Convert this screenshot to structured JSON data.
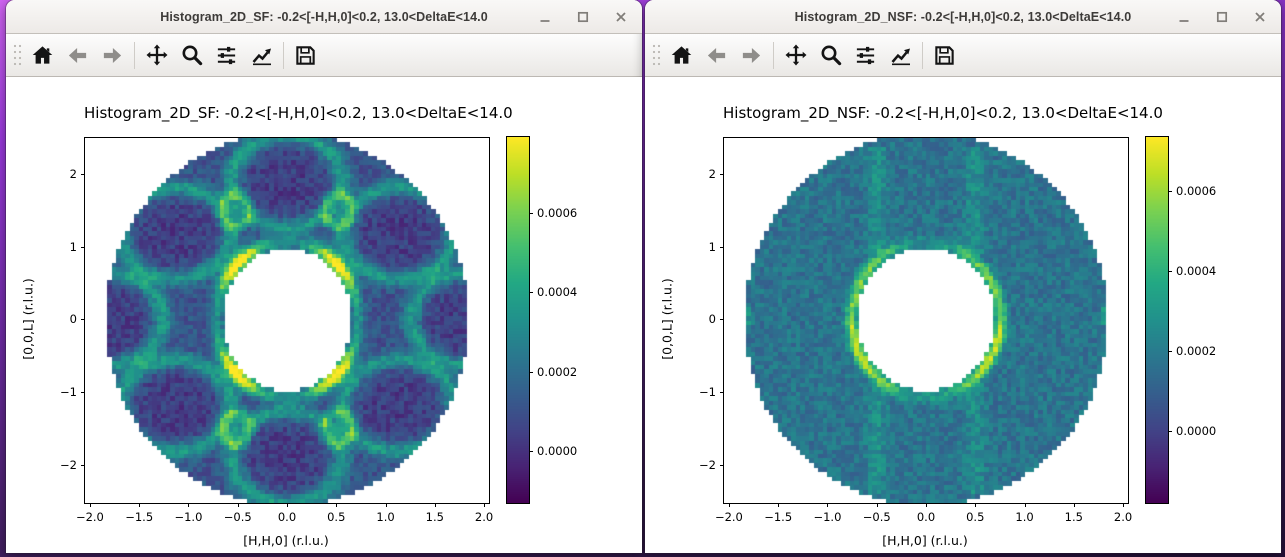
{
  "colors": {
    "desktop_top": "#d064f2",
    "desktop_bottom": "#241038",
    "titlebar_text": "#3d3b39",
    "toolbar_icon": "#141414",
    "toolbar_icon_disabled": "#8f8d8a",
    "colormap": "viridis"
  },
  "windows": [
    {
      "title": "Histogram_2D_SF: -0.2<[-H,H,0]<0.2, 13.0<DeltaE<14.0",
      "controls": [
        "minimize",
        "maximize",
        "close"
      ],
      "toolbar_icons": [
        "home",
        "back",
        "forward",
        "pan",
        "zoom",
        "configure-subplots",
        "edit-parameters",
        "save"
      ],
      "figure": {
        "title": "Histogram_2D_SF: -0.2<[-H,H,0]<0.2, 13.0<DeltaE<14.0",
        "xlabel": "[H,H,0] (r.l.u.)",
        "ylabel": "[0,0,L] (r.l.u.)"
      }
    },
    {
      "title": "Histogram_2D_NSF: -0.2<[-H,H,0]<0.2, 13.0<DeltaE<14.0",
      "controls": [
        "minimize",
        "maximize",
        "close"
      ],
      "toolbar_icons": [
        "home",
        "back",
        "forward",
        "pan",
        "zoom",
        "configure-subplots",
        "edit-parameters",
        "save"
      ],
      "figure": {
        "title": "Histogram_2D_NSF: -0.2<[-H,H,0]<0.2, 13.0<DeltaE<14.0",
        "xlabel": "[H,H,0] (r.l.u.)",
        "ylabel": "[0,0,L] (r.l.u.)"
      }
    }
  ],
  "chart_data": [
    {
      "type": "heatmap",
      "title": "Histogram_2D_SF: -0.2<[-H,H,0]<0.2, 13.0<DeltaE<14.0",
      "xlabel": "[H,H,0] (r.l.u.)",
      "ylabel": "[0,0,L] (r.l.u.)",
      "colormap": "viridis",
      "x_range": [
        -2.05,
        2.05
      ],
      "y_range": [
        -2.53,
        2.5
      ],
      "xticks": {
        "values": [
          -2.0,
          -1.5,
          -1.0,
          -0.5,
          0.0,
          0.5,
          1.0,
          1.5,
          2.0
        ],
        "labels": [
          "−2.0",
          "−1.5",
          "−1.0",
          "−0.5",
          "0.0",
          "0.5",
          "1.0",
          "1.5",
          "2.0"
        ]
      },
      "yticks": {
        "values": [
          -2,
          -1,
          0,
          1,
          2
        ],
        "labels": [
          "−2",
          "−1",
          "0",
          "1",
          "2"
        ]
      },
      "vmin": -0.000131,
      "vmax": 0.000792,
      "colorbar_ticks": {
        "values": [
          0.0,
          0.0002,
          0.0004,
          0.0006
        ],
        "labels": [
          "0.0000",
          "0.0002",
          "0.0004",
          "0.0006"
        ]
      },
      "annulus": {
        "outer_semi_axes": [
          1.84,
          2.56
        ],
        "inner_semi_axes": [
          0.655,
          0.985
        ]
      },
      "render": {
        "seed": 7,
        "bins": [
          90,
          82
        ],
        "base": 0.00013,
        "noise": 7.5e-05,
        "dark_blobs": {
          "amp": 0.0001,
          "sigma": [
            0.42,
            0.46
          ],
          "centers": [
            [
              0,
              1.9
            ],
            [
              0,
              -1.9
            ],
            [
              1.13,
              1.19
            ],
            [
              -1.13,
              1.19
            ],
            [
              1.13,
              -1.19
            ],
            [
              -1.13,
              -1.19
            ],
            [
              1.82,
              0
            ],
            [
              -1.82,
              0
            ]
          ]
        },
        "halos": {
          "amp": 0.00028,
          "width": 0.13,
          "rx": 0.56,
          "ry": 0.63,
          "centers": [
            [
              0,
              1.9
            ],
            [
              0,
              -1.9
            ],
            [
              1.13,
              1.19
            ],
            [
              -1.13,
              1.19
            ],
            [
              1.13,
              -1.19
            ],
            [
              -1.13,
              -1.19
            ],
            [
              1.82,
              0
            ],
            [
              -1.82,
              0
            ]
          ]
        },
        "loops": {
          "amp": 0.00026,
          "width": 0.25,
          "rx": 0.14,
          "ry": 0.22,
          "centers": [
            [
              0.52,
              1.5
            ],
            [
              -0.52,
              1.5
            ],
            [
              0.52,
              -1.5
            ],
            [
              -0.52,
              -1.5
            ]
          ]
        },
        "rim": {
          "rx": 0.72,
          "ry": 1.07,
          "w": 0.07,
          "base": 0.00022,
          "diag": 0.00055,
          "diag_pow": 3
        }
      }
    },
    {
      "type": "heatmap",
      "title": "Histogram_2D_NSF: -0.2<[-H,H,0]<0.2, 13.0<DeltaE<14.0",
      "xlabel": "[H,H,0] (r.l.u.)",
      "ylabel": "[0,0,L] (r.l.u.)",
      "colormap": "viridis",
      "x_range": [
        -2.05,
        2.05
      ],
      "y_range": [
        -2.53,
        2.5
      ],
      "xticks": {
        "values": [
          -2.0,
          -1.5,
          -1.0,
          -0.5,
          0.0,
          0.5,
          1.0,
          1.5,
          2.0
        ],
        "labels": [
          "−2.0",
          "−1.5",
          "−1.0",
          "−0.5",
          "0.0",
          "0.5",
          "1.0",
          "1.5",
          "2.0"
        ]
      },
      "yticks": {
        "values": [
          -2,
          -1,
          0,
          1,
          2
        ],
        "labels": [
          "−2",
          "−1",
          "0",
          "1",
          "2"
        ]
      },
      "vmin": -0.00018,
      "vmax": 0.000736,
      "colorbar_ticks": {
        "values": [
          0.0,
          0.0002,
          0.0004,
          0.0006
        ],
        "labels": [
          "0.0000",
          "0.0002",
          "0.0004",
          "0.0006"
        ]
      },
      "annulus": {
        "outer_semi_axes": [
          1.84,
          2.56
        ],
        "inner_semi_axes": [
          0.7,
          0.985
        ]
      },
      "render": {
        "seed": 12,
        "bins": [
          90,
          82
        ],
        "base": 0.00017,
        "noise": 8e-05,
        "rim": {
          "rx": 0.755,
          "ry": 1.06,
          "w": 0.06,
          "base": 0.0001,
          "side": 0.00026,
          "diag": 0.00012,
          "diag_pow": 2,
          "bottom_boost": 1.25
        },
        "specks": [
          {
            "c": [
              -1.85,
              -0.03
            ],
            "amp": 0.0006,
            "sigma": 0.035
          },
          {
            "c": [
              1.85,
              -0.03
            ],
            "amp": 0.0006,
            "sigma": 0.035
          },
          {
            "c": [
              -1.84,
              0.12
            ],
            "amp": 0.00035,
            "sigma": 0.04
          },
          {
            "c": [
              1.84,
              0.12
            ],
            "amp": 0.00035,
            "sigma": 0.04
          }
        ],
        "streaks": {
          "amp": 0.0001,
          "w": 0.07,
          "xs": [
            -0.5,
            0.5
          ],
          "ymin": 0.9,
          "ymax": 2.4
        }
      }
    }
  ]
}
